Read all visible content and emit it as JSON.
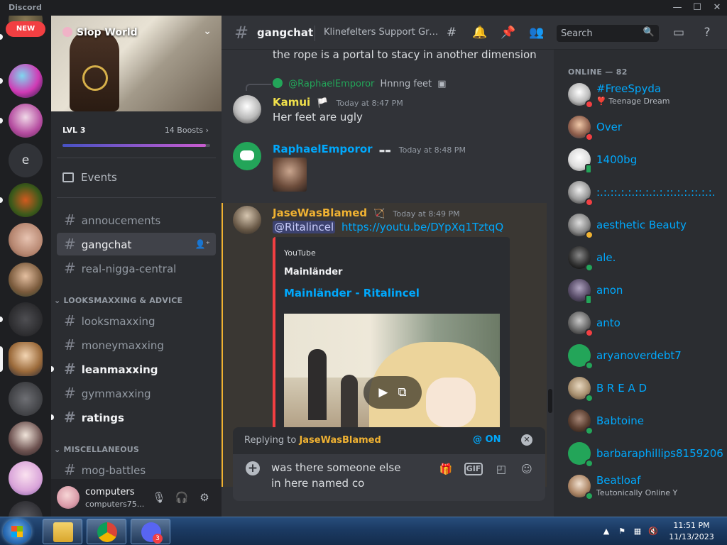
{
  "window": {
    "title": "Discord"
  },
  "rail": {
    "new_label": "NEW",
    "letter_server": "e"
  },
  "server": {
    "name": "Slop World",
    "level": "LVL 3",
    "boosts": "14 Boosts",
    "boost_progress": 0.97
  },
  "sidebar": {
    "events_label": "Events",
    "channels_top": [
      {
        "name": "annoucements",
        "state": "normal"
      },
      {
        "name": "gangchat",
        "state": "active"
      },
      {
        "name": "real-nigga-central",
        "state": "normal"
      }
    ],
    "category1": "LOOKSMAXXING & ADVICE",
    "channels_looks": [
      {
        "name": "looksmaxxing",
        "state": "normal"
      },
      {
        "name": "moneymaxxing",
        "state": "normal"
      },
      {
        "name": "leanmaxxing",
        "state": "unread"
      },
      {
        "name": "gymmaxxing",
        "state": "normal"
      },
      {
        "name": "ratings",
        "state": "unread"
      }
    ],
    "category2": "MISCELLANEOUS",
    "channels_misc": [
      {
        "name": "mog-battles",
        "state": "normal"
      }
    ]
  },
  "user": {
    "name": "computers",
    "tag": "computers75..."
  },
  "header": {
    "channel": "gangchat",
    "topic": "Klinefelters Support Gro...",
    "search_placeholder": "Search"
  },
  "messages": {
    "prev_line": "the rope is a portal to stacy in another dimension",
    "msg1": {
      "reply_to": "@RaphaelEmporor",
      "reply_text": "Hnnng feet",
      "author": "Kamui",
      "author_color": "#f0e04b",
      "time": "Today at 8:47 PM",
      "text": "Her feet are ugly"
    },
    "msg2": {
      "author": "RaphaelEmporor",
      "author_color": "#00a8fc",
      "time": "Today at 8:48 PM"
    },
    "msg3": {
      "author": "JaseWasBlamed",
      "author_color": "#f0b232",
      "time": "Today at 8:49 PM",
      "mention": "@Ritalincel",
      "link": "https://youtu.be/DYpXq1TztqQ",
      "embed": {
        "provider": "YouTube",
        "author": "Mainländer",
        "title": "Mainländer - Ritalincel"
      }
    }
  },
  "reply_bar": {
    "prefix": "Replying to",
    "target": "JaseWasBlamed",
    "mention_toggle": "@ ON"
  },
  "composer": {
    "value": "was there someone else in here named co",
    "gif_label": "GIF"
  },
  "members": {
    "group": "ONLINE — 82",
    "list": [
      {
        "name": "#FreeSpyda",
        "activity": "❣️ Teenage Dream",
        "status": "dnd"
      },
      {
        "name": "Over",
        "activity": "",
        "status": "dnd"
      },
      {
        "name": "1400bg",
        "activity": "",
        "status": "mobile"
      },
      {
        "name": ":.:.::.:.:.::.:.:.:.::.:.:.::.:.:.",
        "activity": "",
        "status": "dnd"
      },
      {
        "name": "aesthetic Beauty",
        "activity": "",
        "status": "idle"
      },
      {
        "name": "ale.",
        "activity": "",
        "status": "online"
      },
      {
        "name": "anon",
        "activity": "",
        "status": "mobile"
      },
      {
        "name": "anto",
        "activity": "",
        "status": "dnd"
      },
      {
        "name": "aryanoverdebt7",
        "activity": "",
        "status": "online"
      },
      {
        "name": "B R E A D",
        "activity": "",
        "status": "online"
      },
      {
        "name": "Babtoine",
        "activity": "",
        "status": "online"
      },
      {
        "name": "barbaraphillips8159206",
        "activity": "",
        "status": "online"
      },
      {
        "name": "Beatloaf",
        "activity": "Teutonically Online Y",
        "status": "online"
      }
    ]
  },
  "taskbar": {
    "time": "11:51 PM",
    "date": "11/13/2023",
    "discord_badge": "3"
  },
  "colors": {
    "accent": "#5865f2",
    "link": "#00a8fc",
    "status_online": "#23a559",
    "status_dnd": "#f23f42",
    "status_idle": "#f0b232"
  }
}
